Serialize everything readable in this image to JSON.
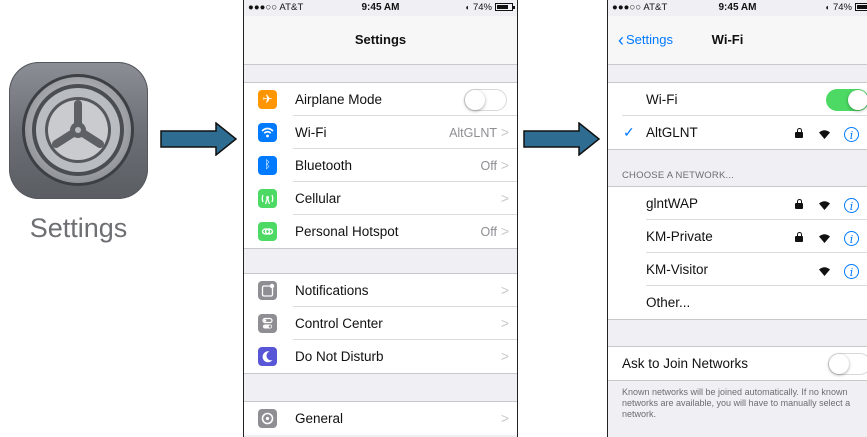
{
  "app_icon": {
    "label": "Settings",
    "icon": "gear-icon"
  },
  "phone_settings": {
    "status": {
      "carrier": "●●●○○ AT&T",
      "time": "9:45 AM",
      "battery": "74%"
    },
    "title": "Settings",
    "group1": [
      {
        "label": "Airplane Mode",
        "icon": "airplane-icon",
        "color": "#ff9500",
        "control": "toggle-off"
      },
      {
        "label": "Wi-Fi",
        "icon": "wifi-icon",
        "color": "#007aff",
        "value": "AltGLNT"
      },
      {
        "label": "Bluetooth",
        "icon": "bluetooth-icon",
        "color": "#007aff",
        "value": "Off"
      },
      {
        "label": "Cellular",
        "icon": "cellular-icon",
        "color": "#4cd964",
        "value": ""
      },
      {
        "label": "Personal Hotspot",
        "icon": "hotspot-icon",
        "color": "#4cd964",
        "value": "Off"
      }
    ],
    "group2": [
      {
        "label": "Notifications",
        "icon": "notifications-icon",
        "color": "#8e8e93"
      },
      {
        "label": "Control Center",
        "icon": "control-center-icon",
        "color": "#8e8e93"
      },
      {
        "label": "Do Not Disturb",
        "icon": "moon-icon",
        "color": "#5856d6"
      }
    ],
    "group3": [
      {
        "label": "General",
        "icon": "gear-icon",
        "color": "#8e8e93"
      }
    ]
  },
  "phone_wifi": {
    "status": {
      "carrier": "●●●○○ AT&T",
      "time": "9:45 AM",
      "battery": "74%"
    },
    "back_label": "Settings",
    "title": "Wi-Fi",
    "wifi_toggle_label": "Wi-Fi",
    "wifi_on": true,
    "connected_network": "AltGLNT",
    "section_header": "CHOOSE A NETWORK...",
    "networks": [
      {
        "name": "glntWAP",
        "locked": true
      },
      {
        "name": "KM-Private",
        "locked": true
      },
      {
        "name": "KM-Visitor",
        "locked": false
      }
    ],
    "other_label": "Other...",
    "ask_label": "Ask to Join Networks",
    "ask_on": false,
    "footer": "Known networks will be joined automatically. If no known networks are available, you will have to manually select a network."
  }
}
